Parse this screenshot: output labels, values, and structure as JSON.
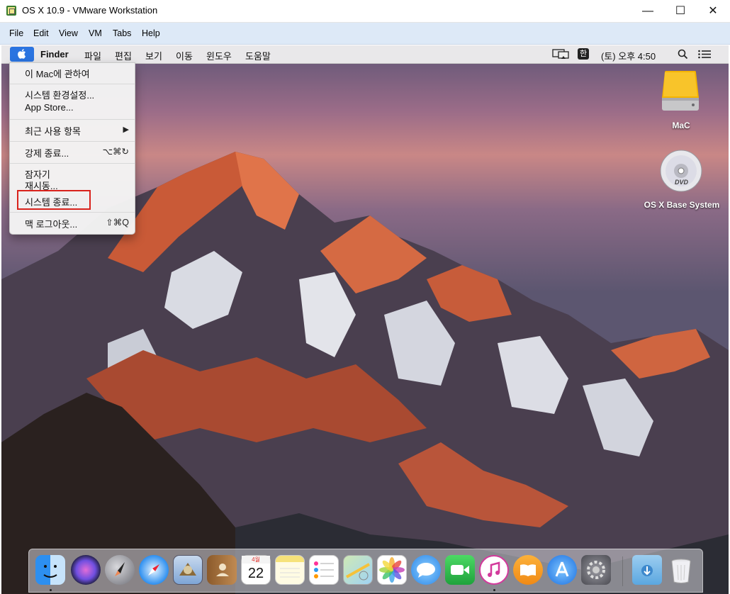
{
  "window": {
    "title": "OS X 10.9 - VMware Workstation",
    "controls": {
      "minimize": "—",
      "maximize": "☐",
      "close": "✕"
    }
  },
  "vmware_menu": [
    "File",
    "Edit",
    "View",
    "VM",
    "Tabs",
    "Help"
  ],
  "mac_menubar": {
    "apple": "",
    "app_name": "Finder",
    "items": [
      "파일",
      "편집",
      "보기",
      "이동",
      "윈도우",
      "도움말"
    ],
    "input_method": "한",
    "clock": "(토) 오후 4:50"
  },
  "apple_menu": {
    "items": [
      {
        "label": "이 Mac에 관하여",
        "shortcut": ""
      },
      {
        "label": "시스템 환경설정...",
        "shortcut": ""
      },
      {
        "label": "App Store...",
        "shortcut": ""
      },
      {
        "label": "최근 사용 항목",
        "shortcut": "▶"
      },
      {
        "label": "강제 종료...",
        "shortcut": "⌥⌘↻"
      },
      {
        "label": "잠자기",
        "shortcut": ""
      },
      {
        "label": "재시동...",
        "shortcut": ""
      },
      {
        "label": "시스템 종료...",
        "shortcut": ""
      },
      {
        "label": "맥 로그아웃...",
        "shortcut": "⇧⌘Q"
      }
    ],
    "highlighted_item": "시스템 종료...",
    "highlight_color": "#d9221c"
  },
  "desktop_icons": [
    {
      "name": "hard-drive-icon",
      "label": "MaC"
    },
    {
      "name": "dvd-icon",
      "label": "OS X Base System"
    }
  ],
  "dvd_badge": "DVD",
  "dock": {
    "calendar_month": "4월",
    "calendar_day": "22",
    "apps": [
      "Finder",
      "Siri",
      "Launchpad",
      "Safari",
      "Mail",
      "Contacts",
      "Calendar",
      "Notes",
      "Reminders",
      "Maps",
      "Photos",
      "Messages",
      "FaceTime",
      "iTunes",
      "iBooks",
      "App Store",
      "System Preferences",
      "Downloads",
      "Trash"
    ]
  },
  "colors": {
    "accent": "#2b74e0",
    "vmware_menubar": "#dde9f7"
  }
}
